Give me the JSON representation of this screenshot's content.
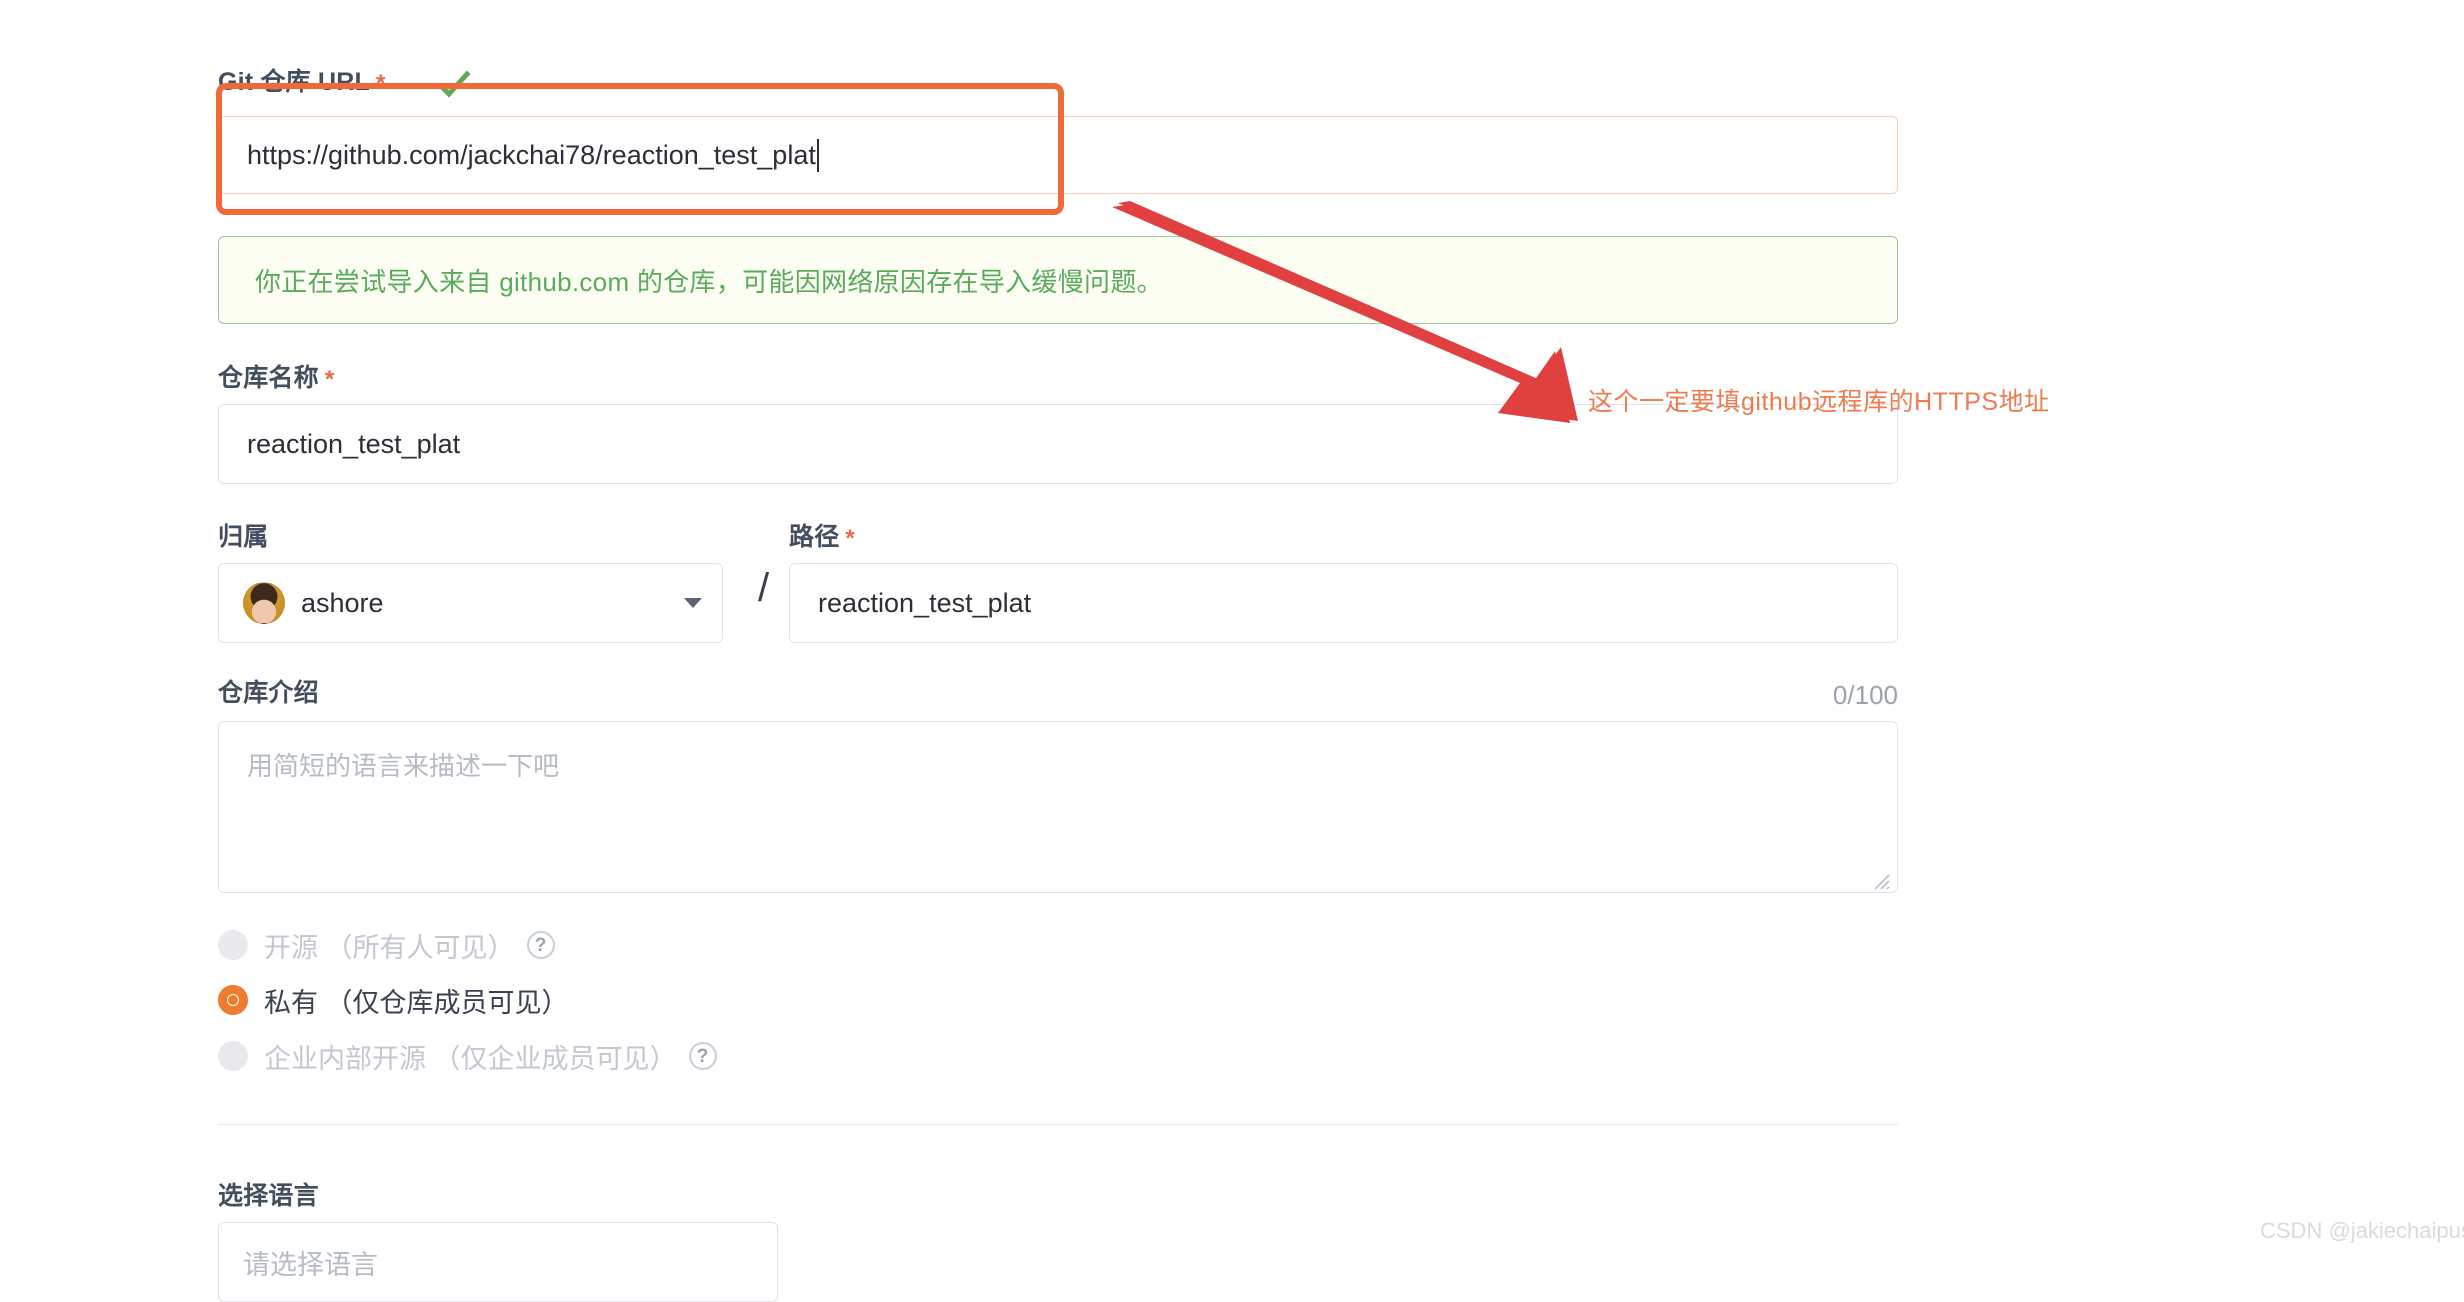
{
  "form": {
    "git_url": {
      "label": "Git 仓库 URL",
      "required_marker": "*",
      "value": "https://github.com/jackchai78/reaction_test_plat",
      "valid_icon": "check-icon",
      "notice": "你正在尝试导入来自 github.com 的仓库，可能因网络原因存在导入缓慢问题。"
    },
    "repo_name": {
      "label": "仓库名称",
      "required_marker": "*",
      "value": "reaction_test_plat"
    },
    "owner": {
      "label": "归属",
      "value": "ashore",
      "avatar": "user-avatar"
    },
    "separator": "/",
    "path": {
      "label": "路径",
      "required_marker": "*",
      "value": "reaction_test_plat"
    },
    "description": {
      "label": "仓库介绍",
      "placeholder": "用简短的语言来描述一下吧",
      "counter": "0/100",
      "value": ""
    },
    "visibility": {
      "options": [
        {
          "label": "开源 （所有人可见）",
          "checked": false,
          "disabled": true,
          "has_help": true
        },
        {
          "label": "私有 （仅仓库成员可见）",
          "checked": true,
          "disabled": false,
          "has_help": false
        },
        {
          "label": "企业内部开源 （仅企业成员可见）",
          "checked": false,
          "disabled": true,
          "has_help": true
        }
      ],
      "help_glyph": "?"
    },
    "language": {
      "label": "选择语言",
      "placeholder": "请选择语言"
    }
  },
  "annotation": {
    "text": "这个一定要填github远程库的HTTPS地址",
    "arrow": "red-arrow",
    "highlight": "orange-highlight-box"
  },
  "watermark": "CSDN @jakiechaipush",
  "colors": {
    "accent_orange": "#ef7b2e",
    "annotation_orange": "#ef6a38",
    "annotation_red": "#e0403f",
    "notice_green": "#5aab5a",
    "notice_bg": "#fcfdf3",
    "label_gray": "#434e5e",
    "disabled_gray": "#c3c7d0"
  }
}
